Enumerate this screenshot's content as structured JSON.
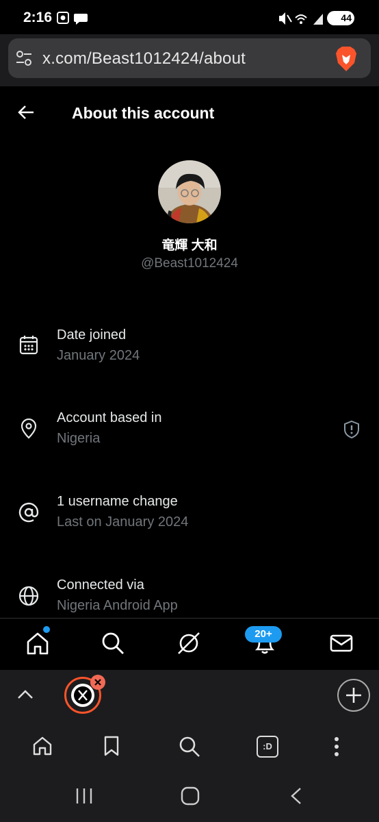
{
  "status_bar": {
    "time": "2:16",
    "battery": "44"
  },
  "browser": {
    "url": "x.com/Beast1012424/about"
  },
  "header": {
    "title": "About this account"
  },
  "profile": {
    "display_name": "竜輝 大和",
    "handle": "@Beast1012424"
  },
  "rows": [
    {
      "title": "Date joined",
      "subtitle": "January 2024",
      "icon": "calendar-icon"
    },
    {
      "title": "Account based in",
      "subtitle": "Nigeria",
      "icon": "location-pin-icon"
    },
    {
      "title": "1 username change",
      "subtitle": "Last on January 2024",
      "icon": "at-sign-icon"
    },
    {
      "title": "Connected via",
      "subtitle": "Nigeria Android App",
      "icon": "globe-icon"
    }
  ],
  "bottom_nav": {
    "items": [
      "home-icon",
      "search-icon",
      "grok-icon",
      "notifications-icon",
      "messages-icon"
    ],
    "notification_count": "20+"
  },
  "brave_toolbar": {
    "tab_switcher_label": ":D"
  },
  "colors": {
    "accent": "#1d9bf0",
    "muted_text": "#71767b",
    "brave_orange": "#fb542b"
  }
}
